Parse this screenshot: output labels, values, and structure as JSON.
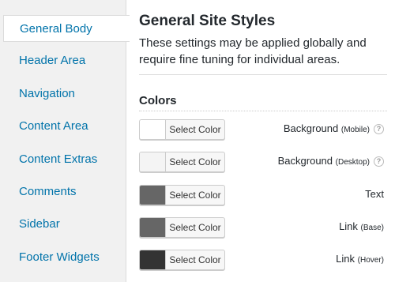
{
  "sidebar": {
    "items": [
      {
        "label": "General Body",
        "active": true
      },
      {
        "label": "Header Area",
        "active": false
      },
      {
        "label": "Navigation",
        "active": false
      },
      {
        "label": "Content Area",
        "active": false
      },
      {
        "label": "Content Extras",
        "active": false
      },
      {
        "label": "Comments",
        "active": false
      },
      {
        "label": "Sidebar",
        "active": false
      },
      {
        "label": "Footer Widgets",
        "active": false
      }
    ]
  },
  "main": {
    "title": "General Site Styles",
    "description": "These settings may be applied globally and require fine tuning for individual areas.",
    "section_title": "Colors",
    "colors": [
      {
        "button_label": "Select Color",
        "swatch_color": "#ffffff",
        "label": "Background",
        "suffix": "(Mobile)",
        "help": "?"
      },
      {
        "button_label": "Select Color",
        "swatch_color": "#f4f4f4",
        "label": "Background",
        "suffix": "(Desktop)",
        "help": "?"
      },
      {
        "button_label": "Select Color",
        "swatch_color": "#666666",
        "label": "Text",
        "suffix": "",
        "help": ""
      },
      {
        "button_label": "Select Color",
        "swatch_color": "#666666",
        "label": "Link",
        "suffix": "(Base)",
        "help": ""
      },
      {
        "button_label": "Select Color",
        "swatch_color": "#333333",
        "label": "Link",
        "suffix": "(Hover)",
        "help": ""
      }
    ]
  },
  "colors": {
    "link": "#0073aa",
    "border": "#dcdcdc",
    "text": "#23282d"
  }
}
